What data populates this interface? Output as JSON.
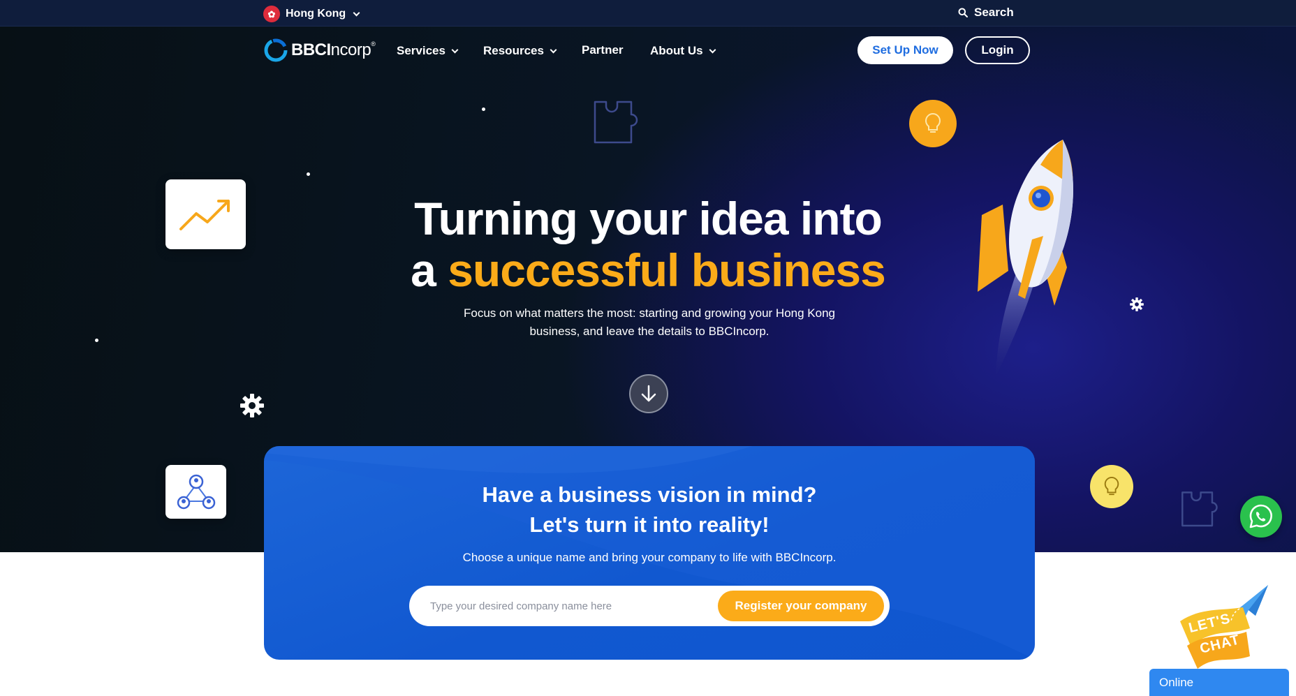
{
  "topbar": {
    "region_label": "Hong Kong",
    "region_flag_icon": "hk-flag-icon",
    "search_label": "Search"
  },
  "nav": {
    "logo_bold": "BBCI",
    "logo_light": "ncorp",
    "logo_mark": "®",
    "items": [
      {
        "label": "Services",
        "has_dropdown": true
      },
      {
        "label": "Resources",
        "has_dropdown": true
      },
      {
        "label": "Partner",
        "has_dropdown": false
      },
      {
        "label": "About Us",
        "has_dropdown": true
      }
    ],
    "setup_label": "Set Up Now",
    "login_label": "Login"
  },
  "hero": {
    "headline_line1": "Turning your idea into",
    "headline_prefix": "a ",
    "headline_highlight": "successful business",
    "subtext": "Focus on what matters the most: starting and growing your Hong Kong business, and leave the details to BBCIncorp."
  },
  "cta": {
    "title_line1": "Have a business vision in mind?",
    "title_line2": "Let's turn it into reality!",
    "subtitle": "Choose a unique name and bring your company to life with BBCIncorp.",
    "input_placeholder": "Type your desired company name here",
    "submit_label": "Register your company"
  },
  "chat": {
    "letschat_line1": "LET'S",
    "letschat_line2": "CHAT",
    "status_label": "Online"
  },
  "colors": {
    "accent": "#fbab19",
    "brand_blue": "#1f6de0",
    "whatsapp": "#2ac14d",
    "online_bar": "#2f88f0"
  }
}
